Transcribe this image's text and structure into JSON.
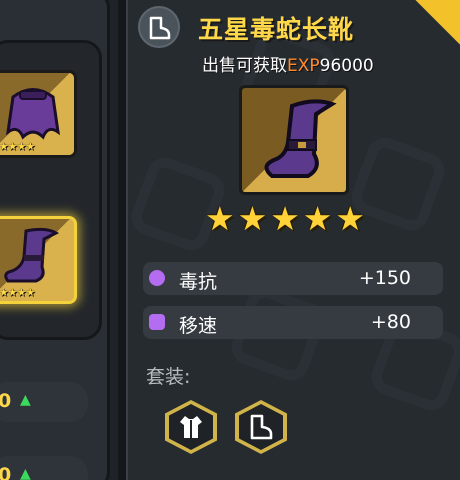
{
  "item": {
    "name": "五星毒蛇长靴",
    "sell_label": "出售可获取",
    "sell_currency": "EXP",
    "sell_amount": "96000",
    "stars": [
      "★",
      "★",
      "★",
      "★",
      "★"
    ]
  },
  "stats": [
    {
      "icon": "shield-icon",
      "label": "毒抗",
      "value": "+150",
      "color": "#b46cf0"
    },
    {
      "icon": "boot-icon",
      "label": "移速",
      "value": "+80",
      "color": "#b46cf0"
    }
  ],
  "set": {
    "label": "套装:",
    "pieces": [
      {
        "icon": "armor-icon"
      },
      {
        "icon": "boot-icon"
      }
    ]
  },
  "inventory": {
    "cards": [
      {
        "name": "cloak",
        "stars": "★★★★★",
        "selected": false
      },
      {
        "name": "boots",
        "stars": "★★★★★",
        "selected": true
      }
    ],
    "pills": [
      {
        "value": "0",
        "arrow": "▲"
      },
      {
        "value": "0",
        "arrow": "▲"
      }
    ]
  },
  "colors": {
    "title": "#ffd84a",
    "exp": "#ff8a2e",
    "star": "#ffd23a",
    "accent": "#f3c22b"
  }
}
